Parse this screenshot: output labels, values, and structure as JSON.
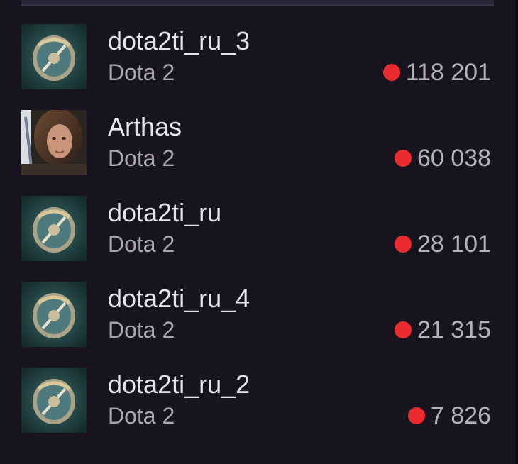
{
  "colors": {
    "background": "#18141f",
    "live_indicator": "#eb2b30",
    "channel_text": "#e6e4ea",
    "secondary_text": "#a9a5b1"
  },
  "channels": [
    {
      "name": "dota2ti_ru_3",
      "game": "Dota 2",
      "viewers": "118 201",
      "avatar": "dota2-aegis-avatar"
    },
    {
      "name": "Arthas",
      "game": "Dota 2",
      "viewers": "60 038",
      "avatar": "streamer-photo-avatar"
    },
    {
      "name": "dota2ti_ru",
      "game": "Dota 2",
      "viewers": "28 101",
      "avatar": "dota2-aegis-avatar"
    },
    {
      "name": "dota2ti_ru_4",
      "game": "Dota 2",
      "viewers": "21 315",
      "avatar": "dota2-aegis-avatar"
    },
    {
      "name": "dota2ti_ru_2",
      "game": "Dota 2",
      "viewers": "7 826",
      "avatar": "dota2-aegis-avatar"
    }
  ]
}
